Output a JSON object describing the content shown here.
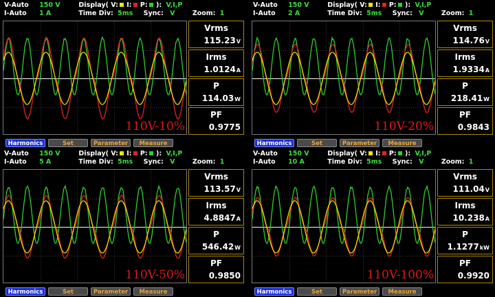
{
  "colors": {
    "voltage": "#f2e600",
    "current": "#e52222",
    "power": "#2fcf2f",
    "caption": "#e21818",
    "label_green": "#3ddc3d"
  },
  "labels": {
    "v_auto": "V-Auto",
    "i_auto": "I-Auto",
    "display": "Display( V:",
    "i_sep": " I:",
    "p_sep": " P:",
    "display_end": " ):",
    "time_div": "Time  Div:",
    "sync": "Sync:",
    "zoom": "Zoom:",
    "vrms": "Vrms",
    "irms": "Irms",
    "p": "P",
    "pf": "PF",
    "harmonics": "Harmonics",
    "set": "Set",
    "parameter": "Parameter",
    "measure": "Measure"
  },
  "panels": [
    {
      "v_range": "150  V",
      "i_range": "1  A",
      "display_mode": "V,I,P",
      "time_div": "5ms",
      "sync": "V",
      "zoom": "1",
      "vrms": "115.23",
      "vrms_unit": "V",
      "irms": "1.0124",
      "irms_unit": "A",
      "p": "114.03",
      "p_unit": "W",
      "pf": "0.9775",
      "caption": "110V-10%",
      "wave": {
        "current_peak_ratio": 1.55,
        "power_level": "high"
      }
    },
    {
      "v_range": "150  V",
      "i_range": "2  A",
      "display_mode": "V,I,P",
      "time_div": "5ms",
      "sync": "V",
      "zoom": "1",
      "vrms": "114.76",
      "vrms_unit": "V",
      "irms": "1.9334",
      "irms_unit": "A",
      "p": "218.41",
      "p_unit": "W",
      "pf": "0.9843",
      "caption": "110V-20%",
      "wave": {
        "current_peak_ratio": 1.3,
        "power_level": "high"
      }
    },
    {
      "v_range": "150  V",
      "i_range": "5  A",
      "display_mode": "V,I,P",
      "time_div": "5ms",
      "sync": "V",
      "zoom": "1",
      "vrms": "113.57",
      "vrms_unit": "V",
      "irms": "4.8847",
      "irms_unit": "A",
      "p": "546.42",
      "p_unit": "W",
      "pf": "0.9850",
      "caption": "110V-50%",
      "wave": {
        "current_peak_ratio": 1.2,
        "power_level": "high"
      }
    },
    {
      "v_range": "150  V",
      "i_range": "10  A",
      "display_mode": "V,I,P",
      "time_div": "5ms",
      "sync": "V",
      "zoom": "1",
      "vrms": "111.04",
      "vrms_unit": "V",
      "irms": "10.238",
      "irms_unit": "A",
      "p": "1.1277",
      "p_unit": "kW",
      "pf": "0.9920",
      "caption": "110V-100%",
      "wave": {
        "current_peak_ratio": 1.12,
        "power_level": "high"
      }
    }
  ]
}
